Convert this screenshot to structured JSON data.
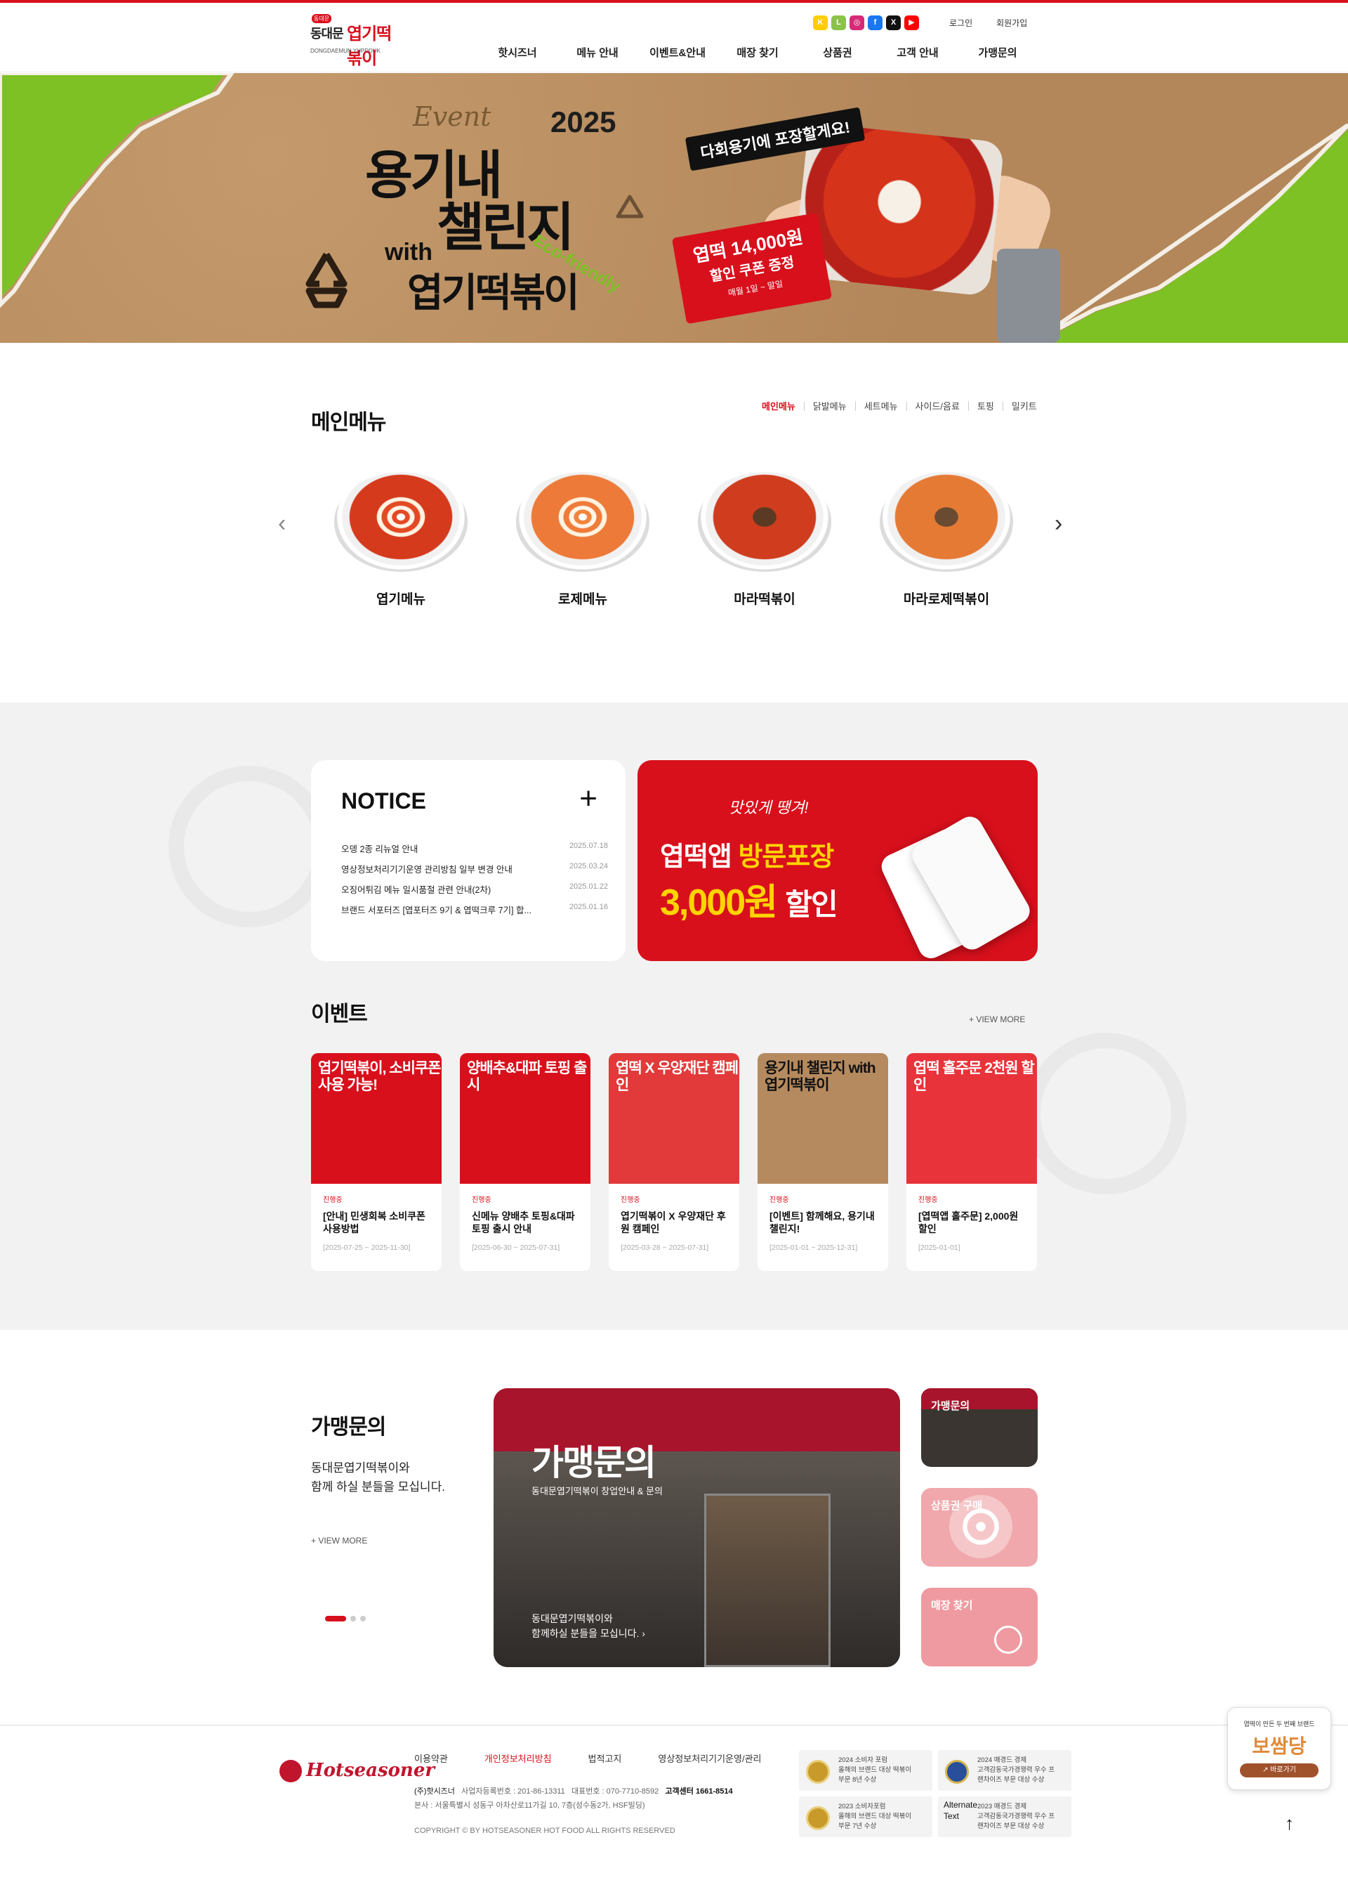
{
  "header": {
    "logo_badge": "동대문",
    "logo_small": "동대문",
    "logo_big": "엽기떡볶이",
    "logo_en": "DONGDAEMUN YUPDDUK",
    "login": "로그인",
    "join": "회원가입",
    "sns": [
      {
        "icon": "kakao-icon",
        "glyph": "K",
        "color": "#ffcd00"
      },
      {
        "icon": "line-icon",
        "glyph": "L",
        "color": "#8bc34a"
      },
      {
        "icon": "instagram-icon",
        "glyph": "◎",
        "color": "#d62976"
      },
      {
        "icon": "facebook-icon",
        "glyph": "f",
        "color": "#1877f2"
      },
      {
        "icon": "x-icon",
        "glyph": "X",
        "color": "#111111"
      },
      {
        "icon": "youtube-icon",
        "glyph": "▶",
        "color": "#ff0000"
      }
    ],
    "nav": [
      "핫시즈너",
      "메뉴 안내",
      "이벤트&안내",
      "매장 찾기",
      "상품권",
      "고객 안내",
      "가맹문의"
    ]
  },
  "hero": {
    "event": "Event",
    "year": "2025",
    "title_line1": "용기내",
    "title_line2": "챌린지",
    "with": "with",
    "brand": "엽기떡볶이",
    "eco": "Eco-friendly",
    "speech": "다회용기에 포장할게요!",
    "coupon_line1": "엽떡 14,000원",
    "coupon_line2": "할인 쿠폰 증정",
    "coupon_line3": "매월 1일 ~ 말일"
  },
  "main_menu": {
    "title": "메인메뉴",
    "tabs": [
      "메인메뉴",
      "닭발메뉴",
      "세트메뉴",
      "사이드/음료",
      "토핑",
      "밀키트"
    ],
    "items": [
      {
        "name": "엽기메뉴",
        "style": "spicy"
      },
      {
        "name": "로제메뉴",
        "style": "rose"
      },
      {
        "name": "마라떡볶이",
        "style": "mala"
      },
      {
        "name": "마라로제떡볶이",
        "style": "malarose"
      }
    ]
  },
  "notice": {
    "title": "NOTICE",
    "items": [
      {
        "text": "오뎅 2종 리뉴얼 안내",
        "date": "2025.07.18"
      },
      {
        "text": "영상정보처리기기운영 관리방침 일부 변경 안내",
        "date": "2025.03.24"
      },
      {
        "text": "오징어튀김 메뉴 일시품절 관련 안내(2차)",
        "date": "2025.01.22"
      },
      {
        "text": "브랜드 서포터즈 [엽포터즈 9기 & 엽떡크루 7기] 합...",
        "date": "2025.01.16"
      }
    ]
  },
  "promo": {
    "tag": "맛있게 땡겨!",
    "line1": "엽떡앱",
    "line1_highlight": "방문포장",
    "line2_amount": "3,000원",
    "line2_suffix": "할인"
  },
  "events": {
    "title": "이벤트",
    "view_more": "+ VIEW MORE",
    "items": [
      {
        "img_text": "엽기떡볶이, 소비쿠폰 사용 가능!",
        "bg": "#d8101c",
        "status": "진행중",
        "title": "[안내] 민생회복 소비쿠폰 사용방법",
        "date": "[2025-07-25 ~ 2025-11-30]"
      },
      {
        "img_text": "양배추&대파 토핑 출시",
        "bg": "#d8101c",
        "status": "진행중",
        "title": "신메뉴 양배추 토핑&대파 토핑 출시 안내",
        "date": "[2025-06-30 ~ 2025-07-31]"
      },
      {
        "img_text": "엽떡 X 우양재단 캠페인",
        "bg": "#e23a3a",
        "status": "진행중",
        "title": "엽기떡볶이 X 우양재단 후원 캠페인",
        "date": "[2025-03-28 ~ 2025-07-31]"
      },
      {
        "img_text": "용기내 챌린지 with 엽기떡볶이",
        "bg": "#b58a5f",
        "status": "진행중",
        "title": "[이벤트] 함께해요, 용기내 챌린지!",
        "date": "[2025-01-01 ~ 2025-12-31]"
      },
      {
        "img_text": "엽떡 홀주문 2천원 할인",
        "bg": "#e8333a",
        "status": "진행중",
        "title": "[엽떡앱 홀주문] 2,000원 할인",
        "date": "[2025-01-01]"
      }
    ]
  },
  "franchise": {
    "title": "가맹문의",
    "desc_line1": "동대문엽기떡볶이와",
    "desc_line2": "함께 하실 분들을 모십니다.",
    "view_more": "+ VIEW MORE",
    "big_title": "가맹문의",
    "big_sub": "동대문엽기떡볶이 창업안내 & 문의",
    "big_bottom1": "동대문엽기떡볶이와",
    "big_bottom2": "함께하실 분들을 모십니다.",
    "side": [
      {
        "label": "가맹문의",
        "bg": "#3a3530"
      },
      {
        "label": "상품권 구매",
        "bg": "#f0a8ac"
      },
      {
        "label": "매장 찾기",
        "bg": "#ef9aa0"
      }
    ]
  },
  "footer": {
    "logo": "Hotseasoner",
    "menu": [
      "이용약관",
      "개인정보처리방침",
      "법적고지",
      "영상정보처리기기운영/관리"
    ],
    "company": "(주)핫시즈너",
    "biz_no": "사업자등록번호 : 201-86-13311",
    "tel": "대표번호 : 070-7710-8592",
    "cs": "고객센터 1661-8514",
    "address": "본사 : 서울특별시 성동구 아차산로11가길 10, 7층(성수동2가, HSF빌딩)",
    "copyright": "COPYRIGHT © BY HOTSEASONER HOT FOOD ALL RIGHTS RESERVED",
    "awards": [
      {
        "l1": "2024 소비자 포럼",
        "l2": "올해의 브랜드 대상 떡볶이",
        "l3": "부문 8년 수상"
      },
      {
        "l1": "2024 매경드 경제",
        "l2": "고객감동국가경쟁력 우수 프",
        "l3": "랜차이즈 부문 대상 수상"
      },
      {
        "l1": "2023 소비자포럼",
        "l2": "올해의 브랜드 대상 떡볶이",
        "l3": "부문 7년 수상"
      },
      {
        "l1": "2023 매경드 경제",
        "l2": "고객감동국가경쟁력 우수 프",
        "l3": "랜차이즈 부문 대상 수상"
      }
    ],
    "alt_text": "Alternate Text"
  },
  "floating": {
    "line1": "엽떡이 만든 두 번째 브랜드",
    "brand": "보쌈당",
    "button": "↗ 바로가기"
  },
  "top_icon": "↑"
}
